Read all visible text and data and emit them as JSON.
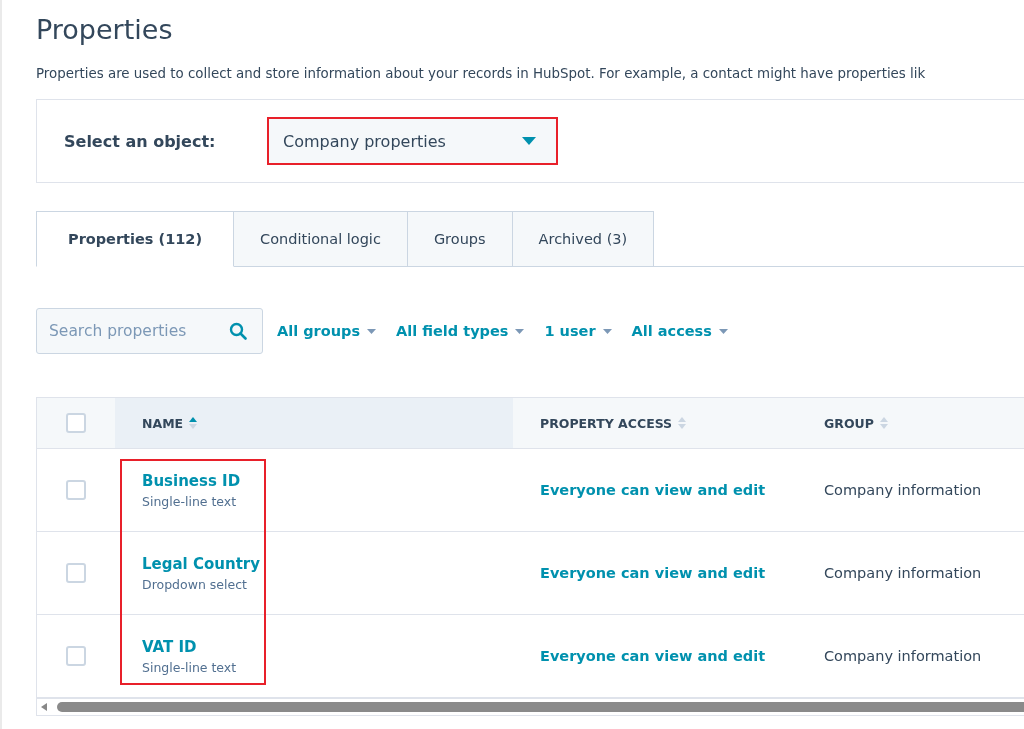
{
  "page": {
    "title": "Properties",
    "description": "Properties are used to collect and store information about your records in HubSpot. For example, a contact might have properties lik"
  },
  "object_select": {
    "label": "Select an object:",
    "value": "Company properties",
    "highlighted": true
  },
  "tabs": [
    {
      "label": "Properties (112)",
      "selected": true
    },
    {
      "label": "Conditional logic",
      "selected": false
    },
    {
      "label": "Groups",
      "selected": false
    },
    {
      "label": "Archived (3)",
      "selected": false
    }
  ],
  "search": {
    "placeholder": "Search properties"
  },
  "filters": [
    "All groups",
    "All field types",
    "1 user",
    "All access"
  ],
  "table": {
    "name_column_highlighted": true,
    "all_checked": false,
    "columns": [
      {
        "label": "NAME",
        "sorted_ascending": true
      },
      {
        "label": "PROPERTY ACCESS",
        "sorted_ascending": false
      },
      {
        "label": "GROUP",
        "sorted_ascending": false
      }
    ],
    "rows": [
      {
        "name": "Business ID",
        "type": "Single-line text",
        "access": "Everyone can view and edit",
        "group": "Company information",
        "checked": false
      },
      {
        "name": "Legal Country",
        "type": "Dropdown select",
        "access": "Everyone can view and edit",
        "group": "Company information",
        "checked": false
      },
      {
        "name": "VAT ID",
        "type": "Single-line text",
        "access": "Everyone can view and edit",
        "group": "Company information",
        "checked": false
      }
    ]
  }
}
